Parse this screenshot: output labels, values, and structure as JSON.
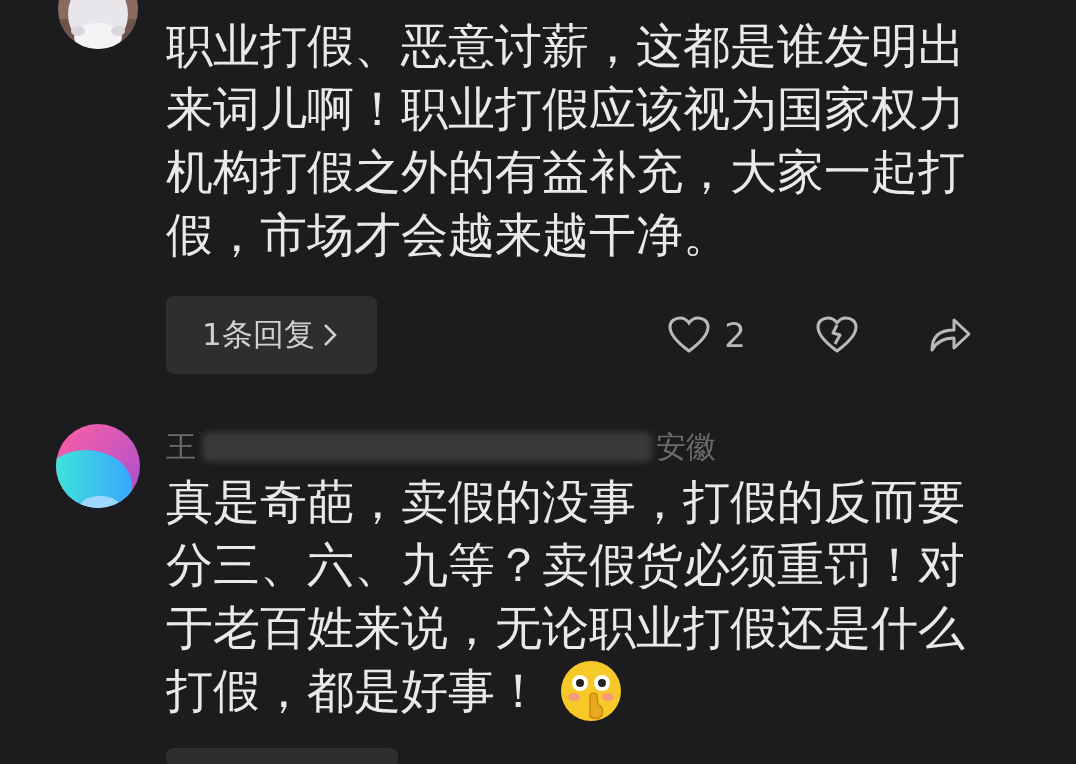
{
  "comments": [
    {
      "text": "职业打假、恶意讨薪，这都是谁发明出来词儿啊！职业打假应该视为国家权力机构打假之外的有益补充，大家一起打假，市场才会越来越干净。",
      "emoji": false,
      "actions": {
        "kind": "full",
        "replies": "1条回复",
        "likes": "2"
      }
    },
    {
      "avatar": {
        "kind": "gradient"
      },
      "author": {
        "name": "王",
        "redacted": true,
        "location": "安徽"
      },
      "text": "真是奇葩，卖假的没事，打假的反而要分三、六、九等？卖假货必须重罚！对于老百姓来说，无论职业打假还是什么打假，都是好事！",
      "emoji": true,
      "actions": {
        "kind": "pill_edge"
      }
    }
  ]
}
